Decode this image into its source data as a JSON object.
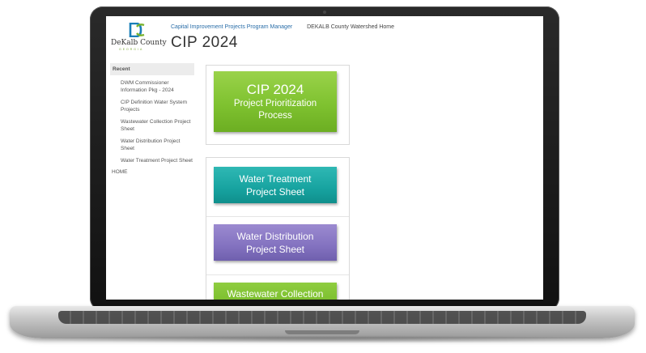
{
  "logo": {
    "name": "DeKalb County",
    "sub": "GEORGIA"
  },
  "topnav": {
    "app_title": "Capital Improvement Projects Program Manager",
    "home_link": "DEKALB County Watershed Home"
  },
  "page_title": "CIP 2024",
  "sidebar": {
    "recent_header": "Recent",
    "items": [
      {
        "label": "DWM Commissioner Information Pkg - 2024"
      },
      {
        "label": "CIP Definition Water System Projects"
      },
      {
        "label": "Wastewater Collection Project Sheet"
      },
      {
        "label": "Water Distribution Project Sheet"
      },
      {
        "label": "Water Treatment Project Sheet"
      }
    ],
    "home": "HOME"
  },
  "tiles": {
    "cip": {
      "line1": "CIP 2024",
      "line2": "Project Prioritization",
      "line3": "Process"
    },
    "water_treatment": {
      "line1": "Water Treatment",
      "line2": "Project Sheet"
    },
    "water_distribution": {
      "line1": "Water Distribution",
      "line2": "Project Sheet"
    },
    "wastewater_collection": {
      "line1": "Wastewater Collection"
    }
  },
  "colors": {
    "cip_tile": "#7fc230",
    "water_treatment_tile": "#17a3a0",
    "water_distribution_tile": "#8372c0",
    "wastewater_tile": "#79bd2c",
    "link_blue": "#2a6ea8"
  }
}
